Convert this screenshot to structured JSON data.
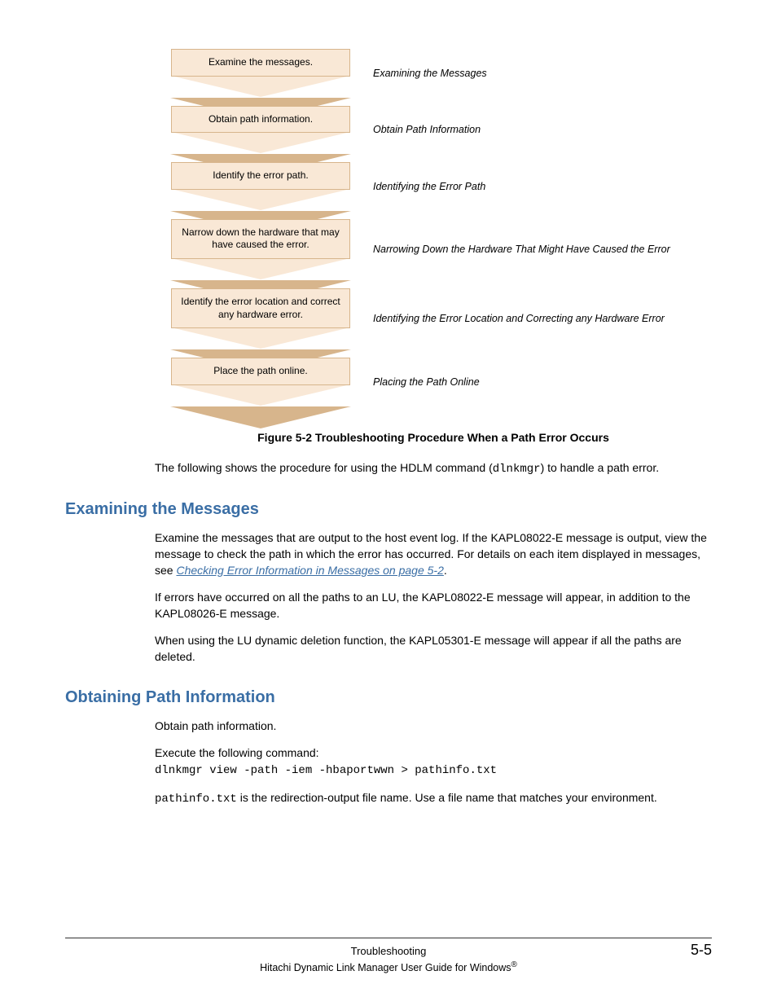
{
  "flowchart": {
    "steps": [
      {
        "box": "Examine the messages.",
        "label": "Examining the Messages"
      },
      {
        "box": "Obtain path information.",
        "label": "Obtain Path Information"
      },
      {
        "box": "Identify the error path.",
        "label": "Identifying the Error Path"
      },
      {
        "box": "Narrow down the hardware that may have caused the error.",
        "label": "Narrowing Down the Hardware That Might Have Caused the Error"
      },
      {
        "box": "Identify the error location and correct any hardware error.",
        "label": "Identifying the Error Location and Correcting any Hardware Error"
      },
      {
        "box": "Place the path online.",
        "label": "Placing the Path Online"
      }
    ]
  },
  "figure_caption": "Figure 5-2 Troubleshooting Procedure When a Path Error Occurs",
  "intro_para_1a": "The following shows the procedure for using the HDLM command (",
  "intro_code": "dlnkmgr",
  "intro_para_1b": ") to handle a path error.",
  "section1": {
    "heading": "Examining the Messages",
    "para1a": "Examine the messages that are output to the host event log. If the KAPL08022-E message is output, view the message to check the path in which the error has occurred. For details on each item displayed in messages, see ",
    "link": "Checking Error Information in Messages on page 5-2",
    "para1b": ".",
    "para2": "If errors have occurred on all the paths to an LU, the KAPL08022-E message will appear, in addition to the KAPL08026-E message.",
    "para3": "When using the LU dynamic deletion function, the KAPL05301-E message will appear if all the paths are deleted."
  },
  "section2": {
    "heading": "Obtaining Path Information",
    "para1": "Obtain path information.",
    "para2": "Execute the following command:",
    "command": "dlnkmgr view -path -iem -hbaportwwn > pathinfo.txt",
    "para3a": "pathinfo.txt",
    "para3b": " is the redirection-output file name. Use a file name that matches your environment."
  },
  "footer": {
    "chapter": "Troubleshooting",
    "pageno": "5-5",
    "guide": "Hitachi Dynamic Link Manager User Guide for Windows",
    "reg": "®"
  }
}
